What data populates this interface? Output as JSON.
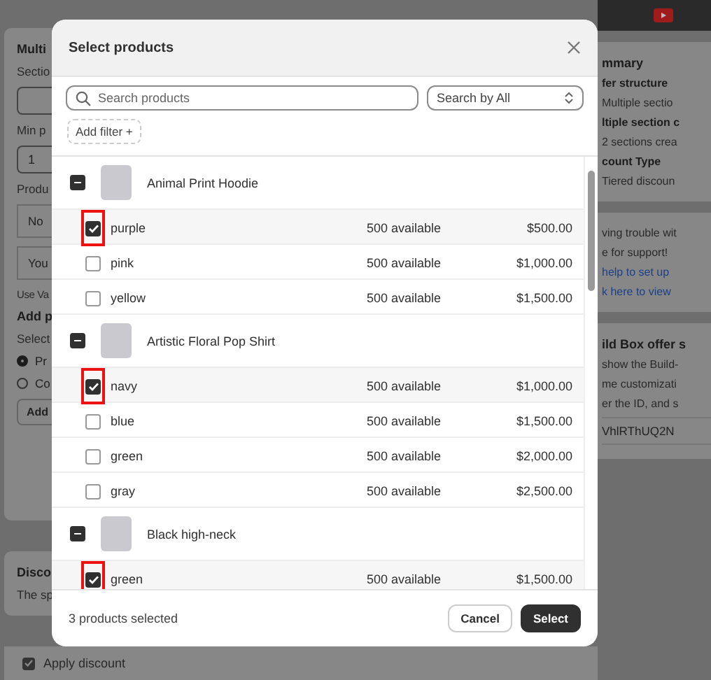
{
  "left_panel": {
    "cards": [
      {
        "items": [
          {
            "kind": "heading",
            "text": "Multi"
          },
          {
            "kind": "label",
            "text": "Sectio"
          },
          {
            "kind": "input"
          },
          {
            "kind": "label",
            "text": "Min p"
          },
          {
            "kind": "input",
            "value": "1"
          },
          {
            "kind": "label",
            "text": "Produ"
          },
          {
            "kind": "cell",
            "text": "No"
          },
          {
            "kind": "cell",
            "text": "You"
          },
          {
            "kind": "help",
            "text": "Use Va"
          },
          {
            "kind": "heading",
            "text": "Add p"
          },
          {
            "kind": "label",
            "text": "Select"
          },
          {
            "kind": "radio",
            "text": "Pr",
            "selected": true
          },
          {
            "kind": "radio",
            "text": "Co",
            "selected": false
          },
          {
            "kind": "button",
            "text": "Add"
          }
        ]
      },
      {
        "items": [
          {
            "kind": "heading",
            "text": "Disco"
          },
          {
            "kind": "label",
            "text": "The sp"
          }
        ]
      }
    ],
    "bottom_checkbox": {
      "label": "Apply discount",
      "checked": true
    }
  },
  "modal": {
    "title": "Select products",
    "search": {
      "placeholder": "Search products"
    },
    "search_by": "Search by All",
    "add_filter": {
      "label": "Add filter",
      "icon": "+"
    },
    "products": [
      {
        "name": "Animal Print Hoodie",
        "partially_selected": true,
        "variants": [
          {
            "name": "purple",
            "available": "500 available",
            "price": "$500.00",
            "checked": true,
            "highlighted": true
          },
          {
            "name": "pink",
            "available": "500 available",
            "price": "$1,000.00",
            "checked": false,
            "highlighted": false
          },
          {
            "name": "yellow",
            "available": "500 available",
            "price": "$1,500.00",
            "checked": false,
            "highlighted": false
          }
        ]
      },
      {
        "name": "Artistic Floral Pop Shirt",
        "partially_selected": true,
        "variants": [
          {
            "name": "navy",
            "available": "500 available",
            "price": "$1,000.00",
            "checked": true,
            "highlighted": true
          },
          {
            "name": "blue",
            "available": "500 available",
            "price": "$1,500.00",
            "checked": false,
            "highlighted": false
          },
          {
            "name": "green",
            "available": "500 available",
            "price": "$2,000.00",
            "checked": false,
            "highlighted": false
          },
          {
            "name": "gray",
            "available": "500 available",
            "price": "$2,500.00",
            "checked": false,
            "highlighted": false
          }
        ]
      },
      {
        "name": "Black high-neck",
        "partially_selected": true,
        "variants": [
          {
            "name": "green",
            "available": "500 available",
            "price": "$1,500.00",
            "checked": true,
            "highlighted": true
          }
        ]
      }
    ],
    "footer": {
      "summary": "3 products selected",
      "buttons": [
        {
          "label": "Cancel",
          "kind": "secondary"
        },
        {
          "label": "Select",
          "kind": "primary"
        }
      ]
    }
  },
  "right_panel": {
    "cards": [
      {
        "items": [
          {
            "kind": "heading",
            "text": "mmary"
          },
          {
            "kind": "subheading",
            "text": "fer structure"
          },
          {
            "kind": "text",
            "text": "Multiple sectio"
          },
          {
            "kind": "subheading",
            "text": "ltiple section c"
          },
          {
            "kind": "text",
            "text": "2 sections crea"
          },
          {
            "kind": "subheading",
            "text": "count Type"
          },
          {
            "kind": "text",
            "text": "Tiered discoun"
          }
        ]
      },
      {
        "items": [
          {
            "kind": "text",
            "text": "ving trouble wit"
          },
          {
            "kind": "text",
            "text": "e for support!"
          },
          {
            "kind": "link",
            "text": "help to set up"
          },
          {
            "kind": "link",
            "text": "k here to view"
          }
        ]
      },
      {
        "items": [
          {
            "kind": "heading",
            "text": "ild Box offer s"
          },
          {
            "kind": "text",
            "text": "show the Build-"
          },
          {
            "kind": "text",
            "text": "me customizati"
          },
          {
            "kind": "text",
            "text": "er the ID, and s"
          },
          {
            "kind": "input",
            "value": "VhlRThUQ2N"
          }
        ]
      }
    ]
  }
}
